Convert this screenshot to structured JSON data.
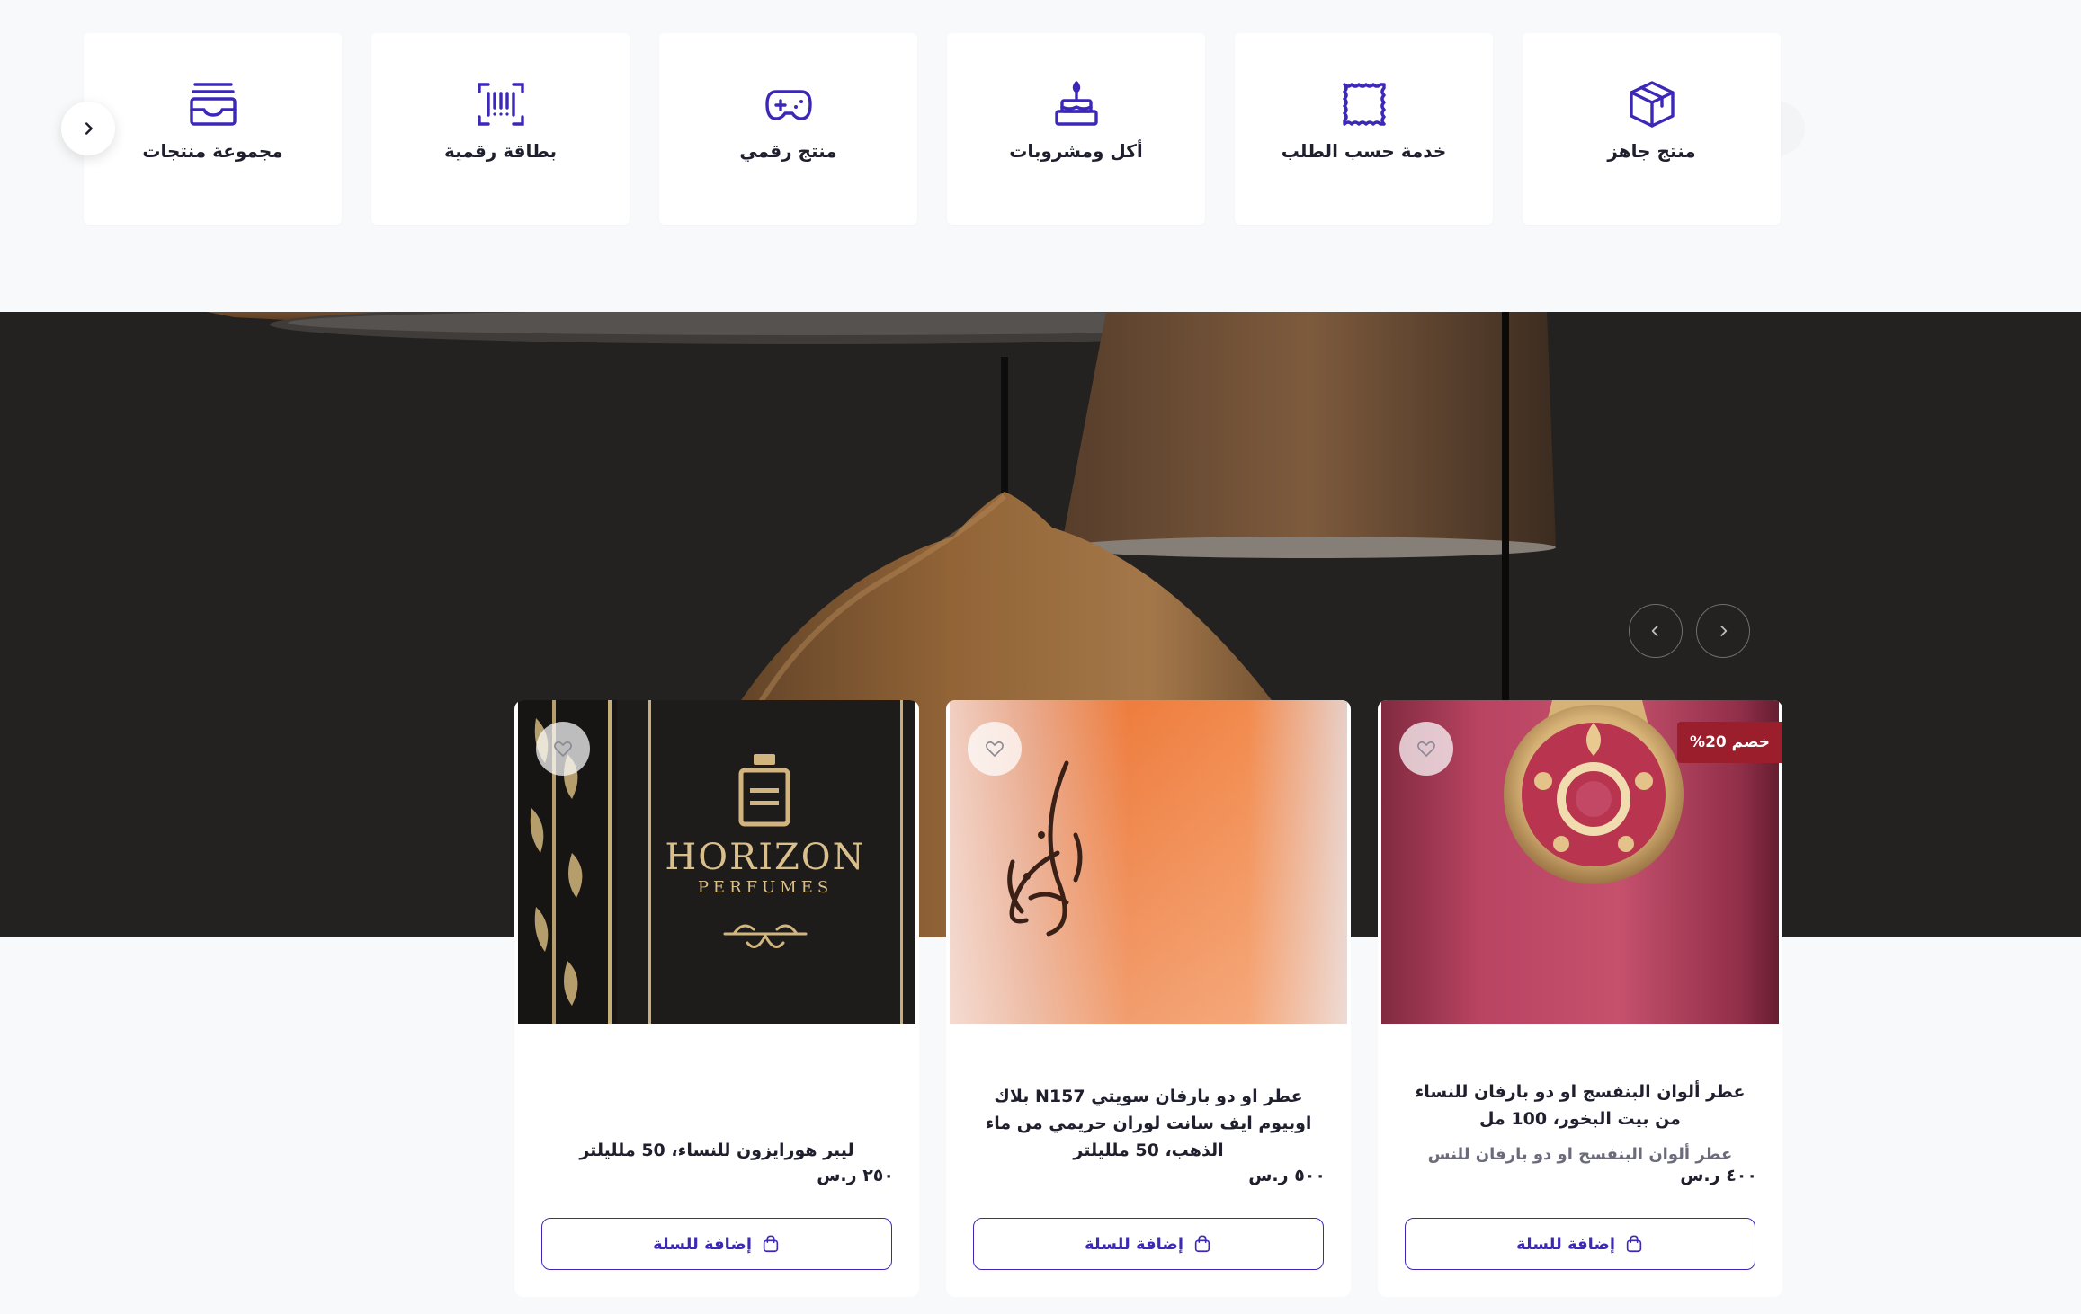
{
  "categories": [
    {
      "label": "منتج جاهز",
      "icon": "box-icon"
    },
    {
      "label": "خدمة حسب الطلب",
      "icon": "stamp-icon"
    },
    {
      "label": "أكل ومشروبات",
      "icon": "cake-icon"
    },
    {
      "label": "منتج رقمي",
      "icon": "gamepad-icon"
    },
    {
      "label": "بطاقة رقمية",
      "icon": "barcode-icon"
    },
    {
      "label": "مجموعة منتجات",
      "icon": "stack-icon"
    }
  ],
  "colors": {
    "accent": "#3b28b8",
    "discount": "#9a1e2b",
    "page_bg": "#f8f9fa"
  },
  "products": [
    {
      "title": "عطر ألوان البنفسج او دو بارفان للنساء من بيت البخور، 100 مل",
      "subtitle": "عطر ألوان البنفسج او دو بارفان للنس",
      "price": "٤٠٠ ر.س",
      "badge": "خصم 20%",
      "add_label": "إضافة للسلة"
    },
    {
      "title": "عطر او دو بارفان سويتي N157 بلاك اوبيوم ايف سانت لوران حريمي من ماء الذهب، 50 ملليلتر",
      "subtitle": "",
      "price": "٥٠٠ ر.س",
      "badge": "",
      "add_label": "إضافة للسلة"
    },
    {
      "title": "ليبر هورايزون للنساء، 50 ملليلتر",
      "subtitle": "",
      "price": "٢٥٠ ر.س",
      "badge": "",
      "add_label": "إضافة للسلة",
      "image_text_brand": "HORIZON",
      "image_text_sub": "PERFUMES"
    }
  ]
}
